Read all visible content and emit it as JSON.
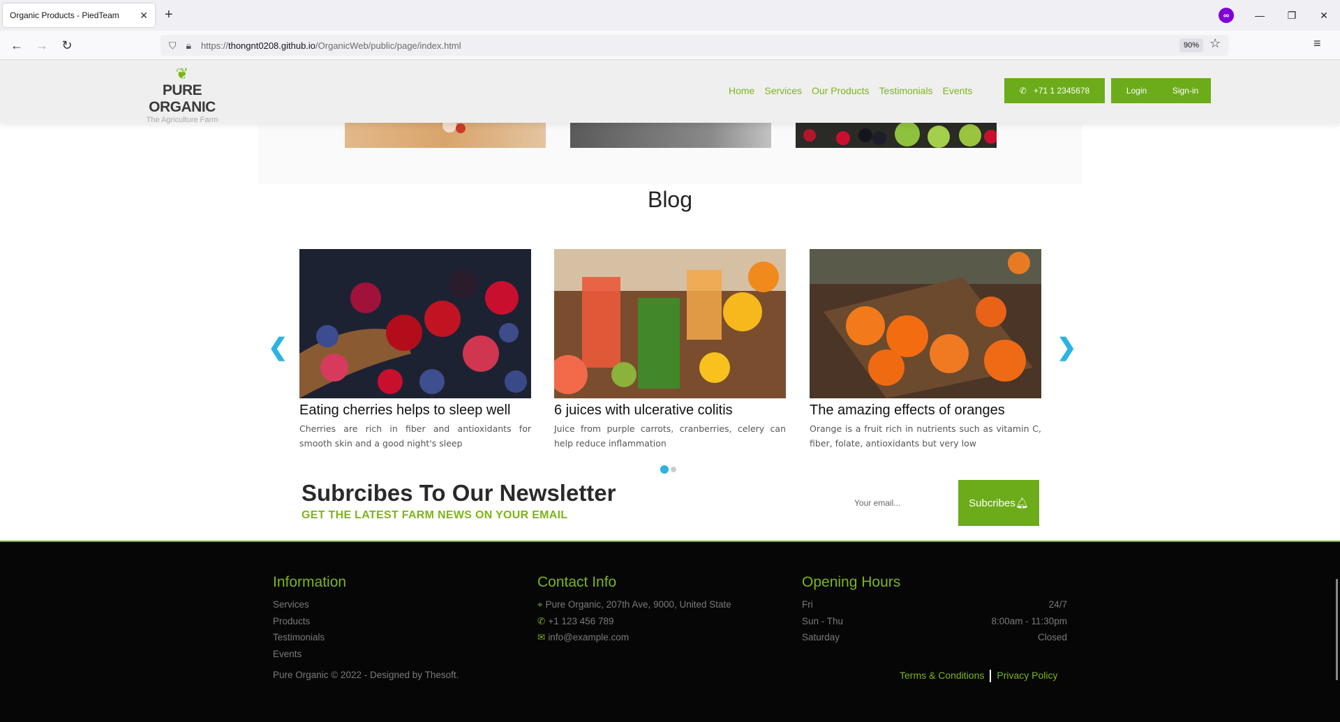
{
  "browser": {
    "tab_title": "Organic Products - PiedTeam",
    "url_scheme": "https://",
    "url_host": "thongnt0208.github.io",
    "url_path": "/OrganicWeb/public/page/index.html",
    "zoom": "90%"
  },
  "header": {
    "logo_name": "PURE ORGANIC",
    "logo_tag": "The Agriculture Farm",
    "nav": [
      "Home",
      "Services",
      "Our Products",
      "Testimonials",
      "Events"
    ],
    "phone": "+71 1 2345678",
    "login": "Login",
    "signin": "Sign-in"
  },
  "blog": {
    "title": "Blog",
    "posts": [
      {
        "title": "Eating cherries helps to sleep well",
        "text": "Cherries are rich in fiber and antioxidants for smooth skin and a good night's sleep"
      },
      {
        "title": "6 juices with ulcerative colitis",
        "text": "Juice from purple carrots, cranberries, celery can help reduce inflammation"
      },
      {
        "title": "The amazing effects of oranges",
        "text": "Orange is a fruit rich in nutrients such as vitamin C, fiber, folate, antioxidants but very low"
      }
    ]
  },
  "newsletter": {
    "title": "Subrcibes To Our Newsletter",
    "subtitle": "GET THE LATEST FARM NEWS ON YOUR EMAIL",
    "placeholder": "Your email...",
    "button": "Subcribes"
  },
  "footer": {
    "info_title": "Information",
    "info_items": [
      "Services",
      "Products",
      "Testimonials",
      "Events"
    ],
    "contact_title": "Contact Info",
    "address": "Pure Organic, 207th Ave, 9000, United State",
    "phone": "+1 123 456 789",
    "email": "info@example.com",
    "hours_title": "Opening Hours",
    "hours": [
      {
        "day": "Fri",
        "time": "24/7"
      },
      {
        "day": "Sun - Thu",
        "time": "8:00am - 11:30pm"
      },
      {
        "day": "Saturday",
        "time": "Closed"
      }
    ],
    "copyright": "Pure Organic © 2022 - Designed by Thesoft.",
    "terms": "Terms & Conditions",
    "privacy": "Privacy Policy"
  },
  "colors": {
    "accent": "#7cb518",
    "button": "#6cac1a",
    "arrow": "#2ab3e4"
  }
}
